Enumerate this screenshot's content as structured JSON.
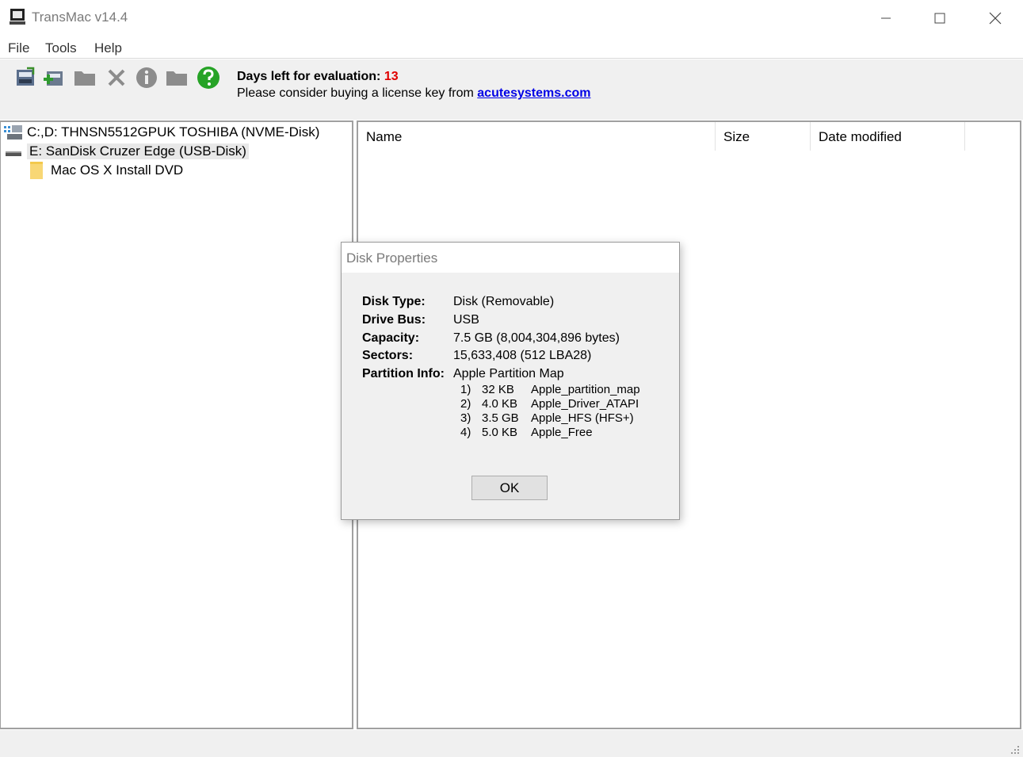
{
  "window": {
    "title": "TransMac v14.4"
  },
  "menu": [
    "File",
    "Tools",
    "Help"
  ],
  "toolbar": {
    "icons": [
      "disk-image-icon",
      "add-disk-icon",
      "folder-icon",
      "delete-icon",
      "info-icon",
      "folder-icon",
      "help-icon"
    ],
    "eval_label": "Days left for evaluation:",
    "eval_days": "13",
    "license_text": "Please consider buying a license key from",
    "license_link": "acutesystems.com"
  },
  "tree": [
    {
      "label": "C:,D:  THNSN5512GPUK TOSHIBA (NVME-Disk)",
      "icon": "disk-tree-icon"
    },
    {
      "label": "E: SanDisk Cruzer Edge (USB-Disk)",
      "icon": "usb-drive-icon"
    },
    {
      "label": "Mac OS X Install DVD",
      "icon": "volume-folder-icon"
    }
  ],
  "file_list": {
    "columns": [
      "Name",
      "Size",
      "Date modified"
    ]
  },
  "dialog": {
    "title": "Disk Properties",
    "props": [
      {
        "label": "Disk Type:",
        "value": "Disk (Removable)"
      },
      {
        "label": "Drive Bus:",
        "value": "USB"
      },
      {
        "label": "Capacity:",
        "value": "7.5 GB (8,004,304,896 bytes)"
      },
      {
        "label": "Sectors:",
        "value": "15,633,408 (512 LBA28)"
      },
      {
        "label": "Partition Info:",
        "value": "Apple Partition Map"
      }
    ],
    "partitions": [
      {
        "num": "1)",
        "size": "32 KB",
        "name": "Apple_partition_map"
      },
      {
        "num": "2)",
        "size": "4.0 KB",
        "name": "Apple_Driver_ATAPI"
      },
      {
        "num": "3)",
        "size": "3.5 GB",
        "name": "Apple_HFS (HFS+)"
      },
      {
        "num": "4)",
        "size": "5.0 KB",
        "name": "Apple_Free"
      }
    ],
    "ok_label": "OK"
  }
}
